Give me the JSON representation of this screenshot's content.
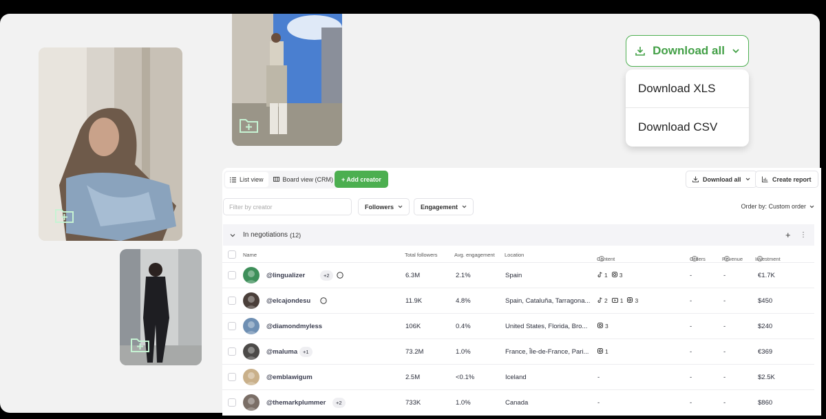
{
  "download_dropdown": {
    "button_label": "Download all",
    "items": [
      "Download XLS",
      "Download CSV"
    ],
    "accent_color": "#43a047"
  },
  "toolbar": {
    "list_view": "List view",
    "board_view": "Board view (CRM)",
    "add_creator": "+ Add creator",
    "download_all": "Download all",
    "create_report": "Create report"
  },
  "filters": {
    "search_placeholder": "Filter by creator",
    "followers": "Followers",
    "engagement": "Engagement",
    "order_by": "Order by: Custom order"
  },
  "group": {
    "title": "In negotiations",
    "count": "(12)",
    "add_label": "+",
    "more_label": "⋮"
  },
  "columns": {
    "name": "Name",
    "followers": "Total followers",
    "engagement": "Avg. engagement",
    "location": "Location",
    "content": "Content",
    "orders": "Orders",
    "revenue": "Revenue",
    "investment": "Investment"
  },
  "rows": [
    {
      "handle": "@lingualizer",
      "extra": "+2",
      "chat": true,
      "followers": "6.3M",
      "engagement": "2.1%",
      "location": "Spain",
      "content": [
        {
          "icon": "tiktok-icon",
          "count": "1"
        },
        {
          "icon": "instagram-icon",
          "count": "3"
        }
      ],
      "orders": "-",
      "revenue": "-",
      "investment": "€1.7K"
    },
    {
      "handle": "@elcajondesu",
      "extra": "",
      "chat": true,
      "followers": "11.9K",
      "engagement": "4.8%",
      "location": "Spain, Cataluña, Tarragona...",
      "content": [
        {
          "icon": "tiktok-icon",
          "count": "2"
        },
        {
          "icon": "youtube-icon",
          "count": "1"
        },
        {
          "icon": "instagram-icon",
          "count": "3"
        }
      ],
      "orders": "-",
      "revenue": "-",
      "investment": "$450"
    },
    {
      "handle": "@diamondmyless",
      "extra": "",
      "chat": false,
      "followers": "106K",
      "engagement": "0.4%",
      "location": "United States, Florida, Bro...",
      "content": [
        {
          "icon": "instagram-icon",
          "count": "3"
        }
      ],
      "orders": "-",
      "revenue": "-",
      "investment": "$240"
    },
    {
      "handle": "@maluma",
      "extra": "+1",
      "chat": false,
      "followers": "73.2M",
      "engagement": "1.0%",
      "location": "France, Île-de-France, Pari...",
      "content": [
        {
          "icon": "instagram-icon",
          "count": "1"
        }
      ],
      "orders": "-",
      "revenue": "-",
      "investment": "€369"
    },
    {
      "handle": "@emblawigum",
      "extra": "",
      "chat": false,
      "followers": "2.5M",
      "engagement": "<0.1%",
      "location": "Iceland",
      "content_text": "-",
      "content": [],
      "orders": "-",
      "revenue": "-",
      "investment": "$2.5K"
    },
    {
      "handle": "@themarkplummer",
      "extra": "+2",
      "chat": false,
      "followers": "733K",
      "engagement": "1.0%",
      "location": "Canada",
      "content_text": "-",
      "content": [],
      "orders": "-",
      "revenue": "-",
      "investment": "$860"
    }
  ]
}
